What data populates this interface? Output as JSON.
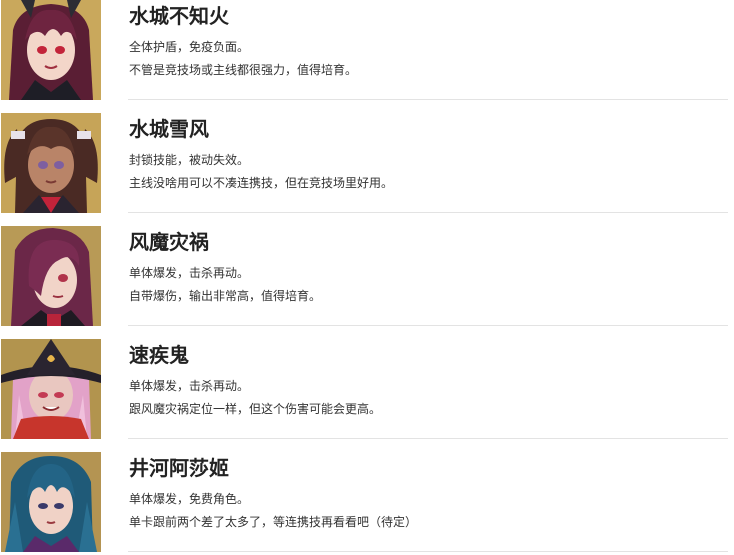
{
  "characters": [
    {
      "name": "水城不知火",
      "line1": "全体护盾，免疫负面。",
      "line2": "不管是竞技场或主线都很强力，值得培育。",
      "portrait": "purple-hair-red-eyes-portrait"
    },
    {
      "name": "水城雪风",
      "line1": "封锁技能，被动失效。",
      "line2": "主线没啥用可以不凑连携技，但在竞技场里好用。",
      "portrait": "brown-twin-tail-dark-skin-portrait"
    },
    {
      "name": "风魔灾祸",
      "line1": "单体爆发，击杀再动。",
      "line2": "自带爆伤，输出非常高，值得培育。",
      "portrait": "long-purple-hair-portrait"
    },
    {
      "name": "速疾鬼",
      "line1": "单体爆发，击杀再动。",
      "line2": "跟风魔灾祸定位一样，但这个伤害可能会更高。",
      "portrait": "witch-hat-pink-hair-portrait"
    },
    {
      "name": "井河阿莎姬",
      "line1": "单体爆发，免费角色。",
      "line2": "单卡跟前两个差了太多了，等连携技再看看吧（待定）",
      "portrait": "blue-hair-portrait"
    }
  ],
  "colors": {
    "divider": "#e3e3e3",
    "name_text": "#222222",
    "desc_text": "#333333"
  }
}
